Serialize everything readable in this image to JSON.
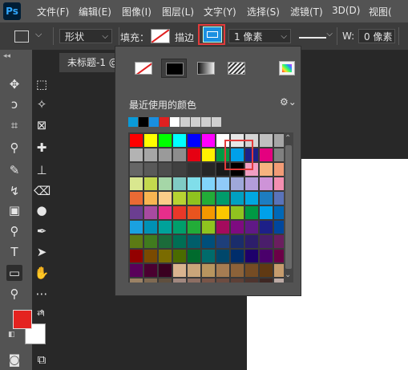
{
  "menu": {
    "logo": "Ps",
    "items": [
      "文件(F)",
      "编辑(E)",
      "图像(I)",
      "图层(L)",
      "文字(Y)",
      "选择(S)",
      "滤镜(T)",
      "3D(D)",
      "视图("
    ]
  },
  "options": {
    "mode": "形状",
    "fill_label": "填充：",
    "stroke_label": "描边",
    "stroke_width": "1 像素",
    "w_label": "W:",
    "w_value": "0 像素"
  },
  "document": {
    "tab_title": "未标题-1 @"
  },
  "swatch_popup": {
    "recent_label": "最近使用的颜色",
    "type_buttons": [
      "no-color",
      "solid-color",
      "gradient",
      "pattern",
      "color-picker"
    ],
    "selected_type": "solid-color",
    "recent_colors": [
      "#0a9ad8",
      "#000000",
      "#1a8fe0",
      "#e02020",
      "#ffffff",
      "#cfcfcf",
      "#cfcfcf",
      "#cfcfcf",
      "#cfcfcf"
    ],
    "selected_swatch": "#00a0e9",
    "swatches": [
      "#ff0000",
      "#ffff00",
      "#00ff00",
      "#00ffff",
      "#0000ff",
      "#ff00ff",
      "#ffffff",
      "#e6e6e6",
      "#d4d4d4",
      "#c0c0c0",
      "#a6a6a6",
      "#999999",
      "#b3b3b3",
      "#a6a6a6",
      "#9a9a9a",
      "#8d8d8d",
      "#e60012",
      "#fff100",
      "#009944",
      "#00a0e9",
      "#1d2088",
      "#e4007f",
      "#808080",
      "#737373",
      "#666666",
      "#595959",
      "#4d4d4d",
      "#404040",
      "#333333",
      "#262626",
      "#1a1a1a",
      "#000000",
      "#f19ec2",
      "#f6b37f",
      "#f29b76",
      "#f08080",
      "#d9e78f",
      "#c3d94e",
      "#a5d6a7",
      "#80cbc4",
      "#80deea",
      "#81d4fa",
      "#90caf9",
      "#9fa8da",
      "#b39ddb",
      "#ce93d8",
      "#f48fb1",
      "#ef9a9a",
      "#ea6a34",
      "#f8b551",
      "#facd89",
      "#b7d332",
      "#8fc31f",
      "#22ac38",
      "#009b6b",
      "#00a0c1",
      "#00a7e1",
      "#1d7dc1",
      "#5a73b9",
      "#2e63ad",
      "#6b3e91",
      "#a84aa0",
      "#e62e8b",
      "#e83828",
      "#e9541f",
      "#f39800",
      "#fcc800",
      "#90c31f",
      "#009944",
      "#00a0e9",
      "#0068b7",
      "#1d2088",
      "#1aa1e0",
      "#0091b5",
      "#00a29a",
      "#009e6b",
      "#22ac38",
      "#8fc31f",
      "#a40b5d",
      "#7e0b80",
      "#601986",
      "#1d2088",
      "#00479d",
      "#005e84",
      "#5c7a14",
      "#407b1e",
      "#1b6b3a",
      "#006e54",
      "#005e6a",
      "#004f7a",
      "#1e3f7a",
      "#1a2d6b",
      "#2d1e6b",
      "#4a1e6b",
      "#6b1e5f",
      "#7a1e33",
      "#930000",
      "#7a4a00",
      "#7a6b00",
      "#4a6b00",
      "#006b2d",
      "#006b6b",
      "#00476b",
      "#002d6b",
      "#1e006b",
      "#4a006b",
      "#6b0047",
      "#6b0020",
      "#5a005a",
      "#4a0030",
      "#3a0020",
      "#d9b48f",
      "#c9a57a",
      "#b8955f",
      "#a67c52",
      "#8c6239",
      "#754c24",
      "#603913",
      "#c69c6d",
      "#dcc49a",
      "#9b8265",
      "#7f6a52",
      "#5f4f3e",
      "#a1887f",
      "#8d6e63",
      "#795548",
      "#6d4c41",
      "#5d4037",
      "#4e342e",
      "#3e2723",
      "#bcaaa4",
      "#d7ccc8"
    ]
  }
}
